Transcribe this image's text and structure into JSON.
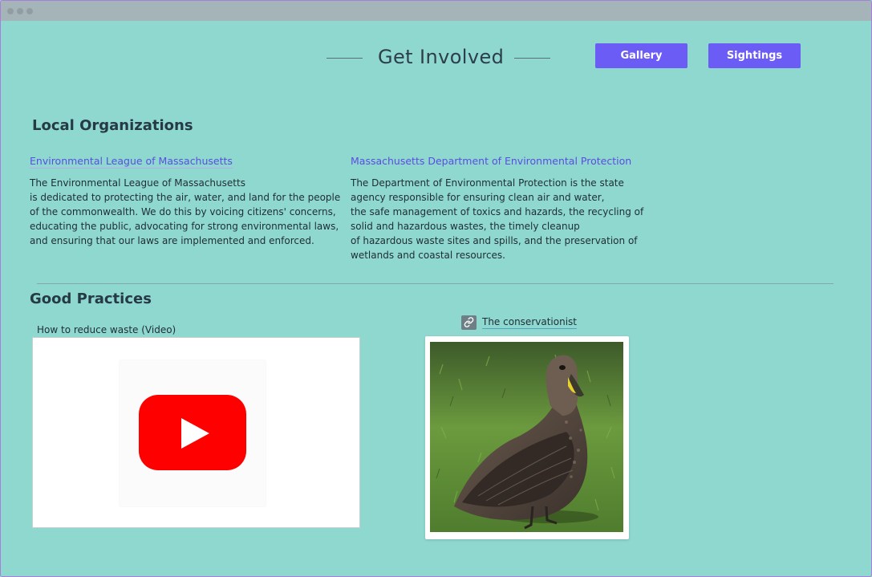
{
  "header": {
    "title": "Get Involved",
    "buttons": {
      "gallery": "Gallery",
      "sightings": "Sightings"
    }
  },
  "local_orgs": {
    "heading": "Local Organizations",
    "items": [
      {
        "link": "Environmental League of Massachusetts",
        "description": "The Environmental League of Massachusetts\nis dedicated to protecting the air, water, and land for the people\nof the commonwealth. We do this by voicing citizens' concerns,\neducating the public, advocating for strong environmental laws,\nand ensuring that our laws are implemented and enforced."
      },
      {
        "link": "Massachusetts Department of Environmental Protection",
        "description": "The Department of Environmental Protection is the state\nagency responsible for ensuring clean air and water,\nthe safe management of toxics and hazards, the recycling of\nsolid and hazardous wastes, the timely cleanup\nof hazardous waste sites and spills, and the preservation of\nwetlands and coastal resources."
      }
    ]
  },
  "good_practices": {
    "heading": "Good Practices",
    "video_caption": "How to reduce waste (Video)",
    "link_text": "The conservationist"
  },
  "icons": {
    "video": "youtube-play-icon",
    "link": "link-icon",
    "photo": "duck-photo"
  },
  "colors": {
    "background": "#8fd8cf",
    "accent": "#6b5cf6",
    "link": "#5a4de0",
    "youtube": "#ff0000"
  }
}
